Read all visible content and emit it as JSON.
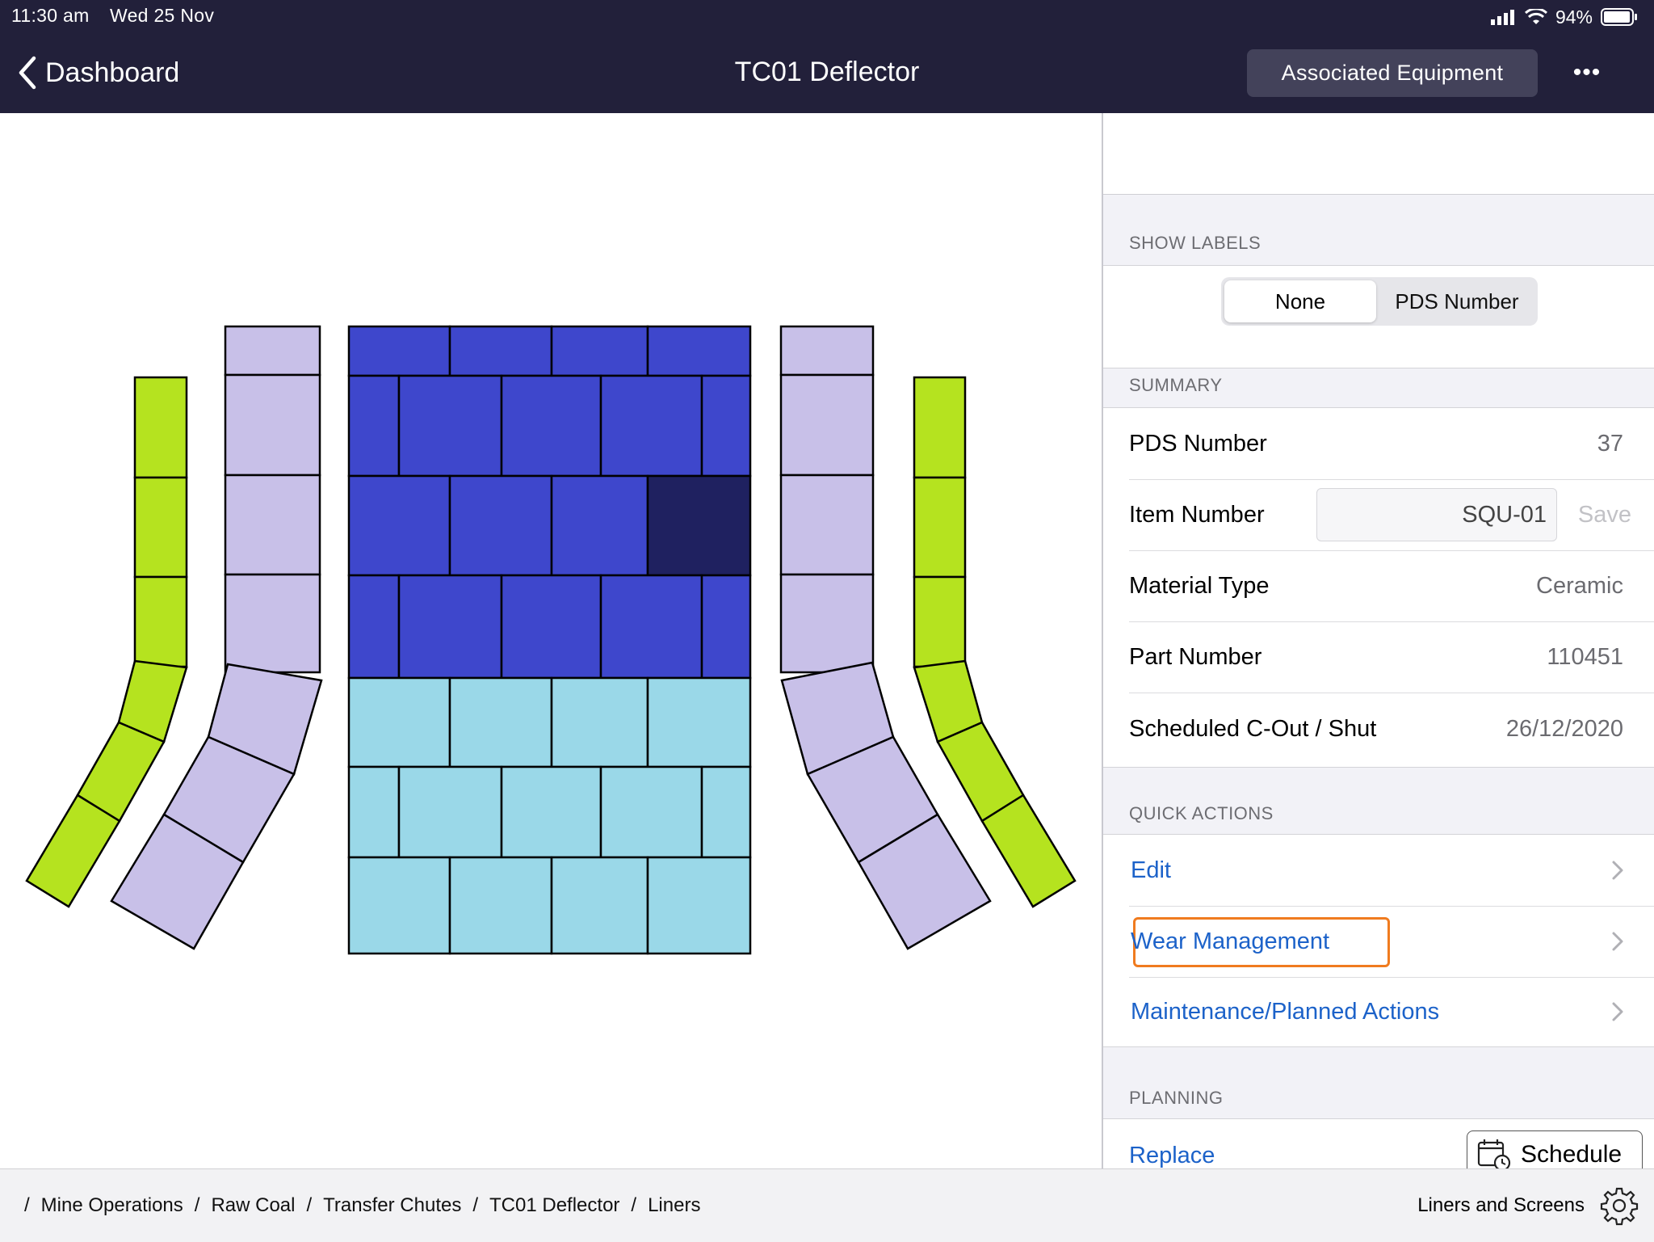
{
  "status": {
    "time": "11:30 am",
    "date": "Wed 25 Nov",
    "battery": "94%"
  },
  "nav": {
    "back_label": "Dashboard",
    "title": "TC01 Deflector",
    "assoc_label": "Associated Equipment",
    "more_label": "•••"
  },
  "panel": {
    "show_labels": {
      "header": "SHOW LABELS",
      "options": [
        "None",
        "PDS Number"
      ],
      "selected": "None"
    },
    "summary": {
      "header": "SUMMARY",
      "pds_key": "PDS Number",
      "pds_val": "37",
      "item_key": "Item Number",
      "item_val": "SQU-01",
      "item_save": "Save",
      "material_key": "Material Type",
      "material_val": "Ceramic",
      "part_key": "Part Number",
      "part_val": "110451",
      "sched_key": "Scheduled C-Out / Shut",
      "sched_val": "26/12/2020"
    },
    "quick_actions": {
      "header": "QUICK ACTIONS",
      "items": [
        "Edit",
        "Wear Management",
        "Maintenance/Planned Actions"
      ],
      "highlighted": "Wear Management"
    },
    "planning": {
      "header": "PLANNING",
      "replace": "Replace",
      "schedule": "Schedule"
    }
  },
  "footer": {
    "breadcrumb": [
      "Mine Operations",
      "Raw Coal",
      "Transfer Chutes",
      "TC01 Deflector",
      "Liners"
    ],
    "right_label": "Liners and Screens"
  },
  "colors": {
    "header_bg": "#22203a",
    "liner_dark_blue": "#3e47cc",
    "liner_navy_selected": "#1f2160",
    "liner_light_blue": "#9ad8e8",
    "liner_lavender": "#c8c0e8",
    "liner_lime": "#b5e31f",
    "link_blue": "#1c62c9",
    "highlight_orange": "#f07b1f"
  }
}
